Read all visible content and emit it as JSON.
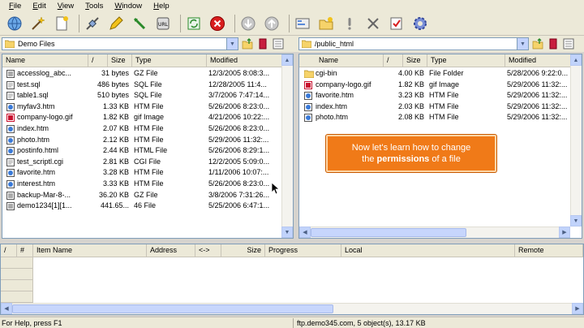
{
  "menu": [
    "File",
    "Edit",
    "View",
    "Tools",
    "Window",
    "Help"
  ],
  "toolbar_icons": [
    "connect-icon",
    "wizard-icon",
    "new-icon",
    "disconnect-icon",
    "edit-icon",
    "bookmark-icon",
    "script-icon",
    "refresh-icon",
    "stop-icon",
    "download-icon",
    "upload-icon",
    "properties-icon",
    "new-folder-icon",
    "bang-icon",
    "delete-icon",
    "check-icon",
    "settings-icon"
  ],
  "local": {
    "path": "Demo Files",
    "columns": [
      "Name",
      "/",
      "Size",
      "Type",
      "Modified"
    ],
    "files": [
      {
        "name": "accesslog_abc...",
        "size": "31 bytes",
        "type": "GZ File",
        "modified": "12/3/2005 8:08:3...",
        "icon": "gz"
      },
      {
        "name": "test.sql",
        "size": "486 bytes",
        "type": "SQL File",
        "modified": "12/28/2005 11:4...",
        "icon": "doc"
      },
      {
        "name": "table1.sql",
        "size": "510 bytes",
        "type": "SQL File",
        "modified": "3/7/2006 7:47:14...",
        "icon": "doc"
      },
      {
        "name": "myfav3.htm",
        "size": "1.33 KB",
        "type": "HTM File",
        "modified": "5/26/2006 8:23:0...",
        "icon": "htm"
      },
      {
        "name": "company-logo.gif",
        "size": "1.82 KB",
        "type": "gif Image",
        "modified": "4/21/2006 10:22:...",
        "icon": "gif"
      },
      {
        "name": "index.htm",
        "size": "2.07 KB",
        "type": "HTM File",
        "modified": "5/26/2006 8:23:0...",
        "icon": "htm"
      },
      {
        "name": "photo.htm",
        "size": "2.12 KB",
        "type": "HTM File",
        "modified": "5/29/2006 11:32:...",
        "icon": "htm"
      },
      {
        "name": "postinfo.html",
        "size": "2.44 KB",
        "type": "HTML File",
        "modified": "5/26/2006 8:29:1...",
        "icon": "htm"
      },
      {
        "name": "test_scriptl.cgi",
        "size": "2.81 KB",
        "type": "CGI File",
        "modified": "12/2/2005 5:09:0...",
        "icon": "doc"
      },
      {
        "name": "favorite.htm",
        "size": "3.28 KB",
        "type": "HTM File",
        "modified": "1/11/2006 10:07:...",
        "icon": "htm"
      },
      {
        "name": "interest.htm",
        "size": "3.33 KB",
        "type": "HTM File",
        "modified": "5/26/2006 8:23:0...",
        "icon": "htm"
      },
      {
        "name": "backup-Mar-8-...",
        "size": "36.20 KB",
        "type": "GZ File",
        "modified": "3/8/2006 7:31:26...",
        "icon": "gz"
      },
      {
        "name": "demo1234[1][1...",
        "size": "441.65...",
        "type": "46 File",
        "modified": "5/25/2006 6:47:1...",
        "icon": "gz"
      }
    ]
  },
  "remote": {
    "path": "/public_html",
    "columns": [
      "Name",
      "/",
      "Size",
      "Type",
      "Modified"
    ],
    "files": [
      {
        "name": "cgi-bin",
        "size": "4.00 KB",
        "type": "File Folder",
        "modified": "5/28/2006 9:22:0...",
        "icon": "folder"
      },
      {
        "name": "company-logo.gif",
        "size": "1.82 KB",
        "type": "gif Image",
        "modified": "5/29/2006 11:32:...",
        "icon": "gif"
      },
      {
        "name": "favorite.htm",
        "size": "3.23 KB",
        "type": "HTM File",
        "modified": "5/29/2006 11:32:...",
        "icon": "htm"
      },
      {
        "name": "index.htm",
        "size": "2.03 KB",
        "type": "HTM File",
        "modified": "5/29/2006 11:32:...",
        "icon": "htm"
      },
      {
        "name": "photo.htm",
        "size": "2.08 KB",
        "type": "HTM File",
        "modified": "5/29/2006 11:32:...",
        "icon": "htm"
      }
    ]
  },
  "queue": {
    "columns": [
      "/",
      "#",
      "Item Name",
      "Address",
      "<->",
      "Size",
      "Progress",
      "Local",
      "Remote"
    ]
  },
  "callout": {
    "line1": "Now let's learn how to change",
    "line2_pre": "the ",
    "line2_bold": "permissions",
    "line2_post": " of a file"
  },
  "status": {
    "help": "For Help, press F1",
    "connection": "ftp.demo345.com, 5 object(s), 13.17 KB"
  },
  "colors": {
    "accent": "#f07a18",
    "frame": "#ece9d8",
    "border": "#7f9db9"
  }
}
